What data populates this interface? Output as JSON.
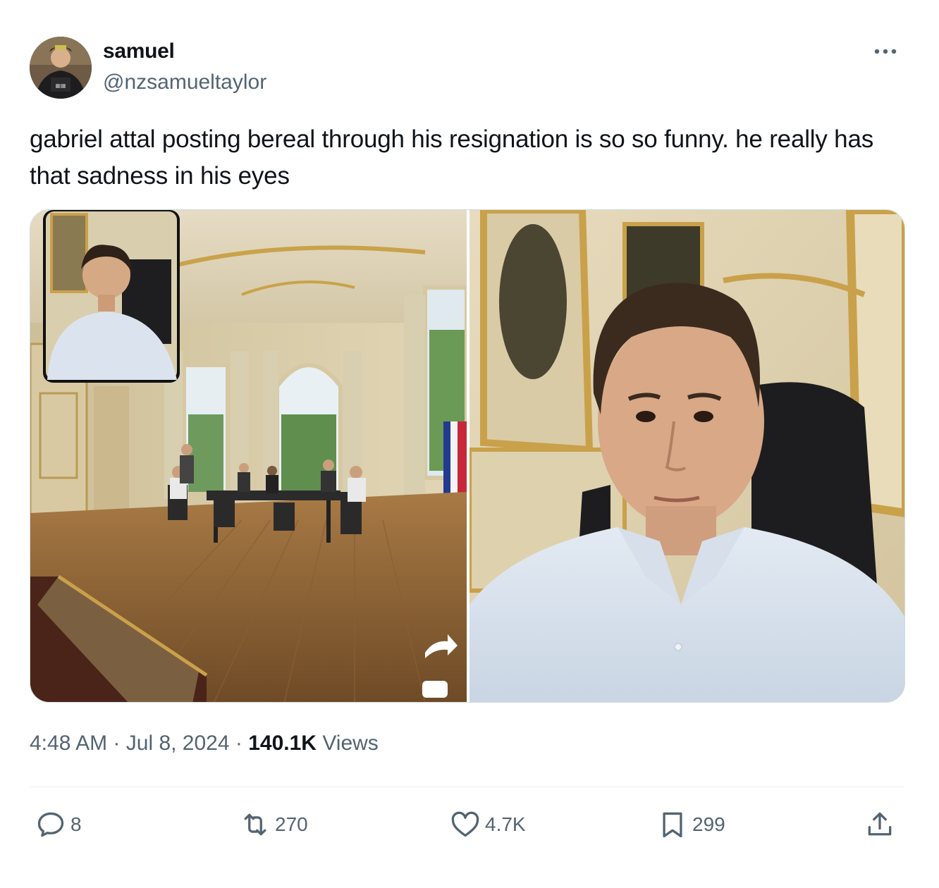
{
  "user": {
    "display_name": "samuel",
    "handle": "@nzsamueltaylor",
    "avatar_icon": "profile-photo"
  },
  "tweet": {
    "text": "gabriel attal posting bereal through his resignation is so so funny. he really has that sadness in his eyes",
    "media": [
      {
        "description_icon": "photo-office-room-with-selfie-inset"
      },
      {
        "description_icon": "photo-selfie-man-in-office"
      }
    ]
  },
  "meta": {
    "time": "4:48 AM",
    "dot1": "·",
    "date": "Jul 8, 2024",
    "dot2": "·",
    "views_count": "140.1K",
    "views_label": "Views"
  },
  "actions": {
    "replies": "8",
    "reposts": "270",
    "likes": "4.7K",
    "bookmarks": "299"
  },
  "colors": {
    "text_primary": "#0f1419",
    "text_secondary": "#536471",
    "border": "#cfd9de"
  }
}
